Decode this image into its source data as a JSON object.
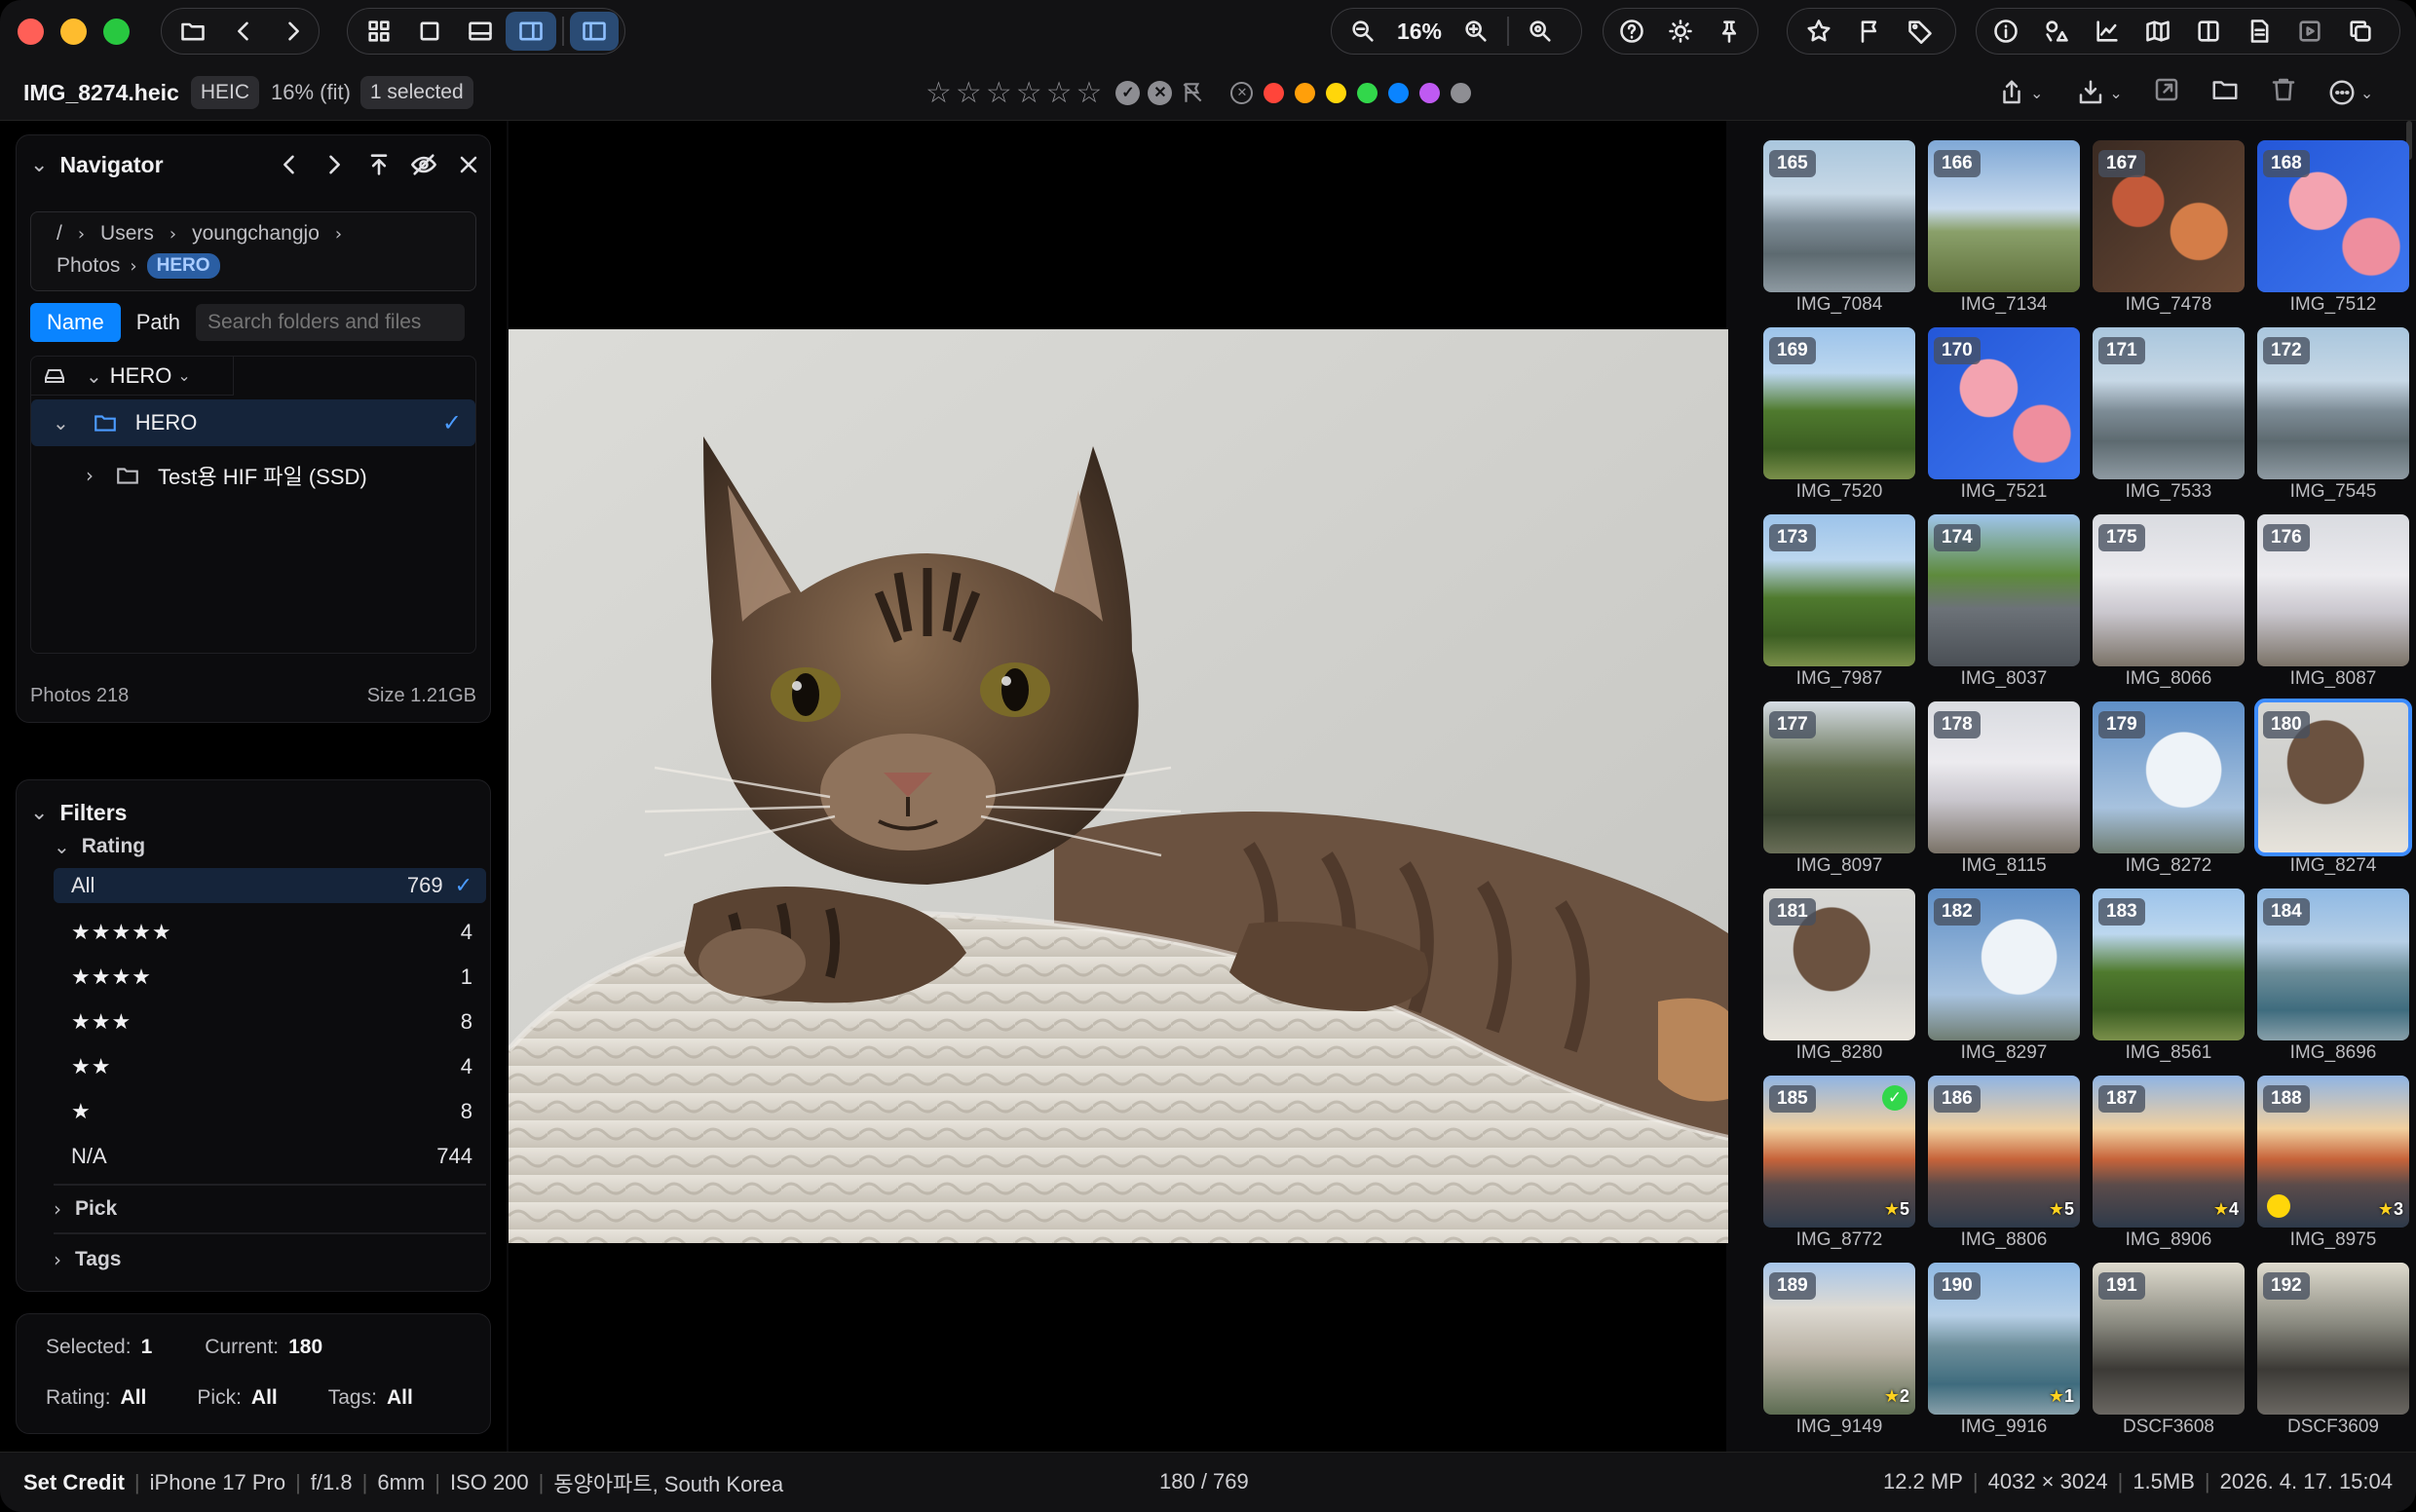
{
  "window": {
    "traffic_lights": {
      "close": "#ff5f57",
      "minimize": "#febc2e",
      "zoom": "#28c840"
    },
    "accent": "#3d8cff"
  },
  "toolbar": {
    "zoom_level": "16%"
  },
  "infobar": {
    "filename": "IMG_8274.heic",
    "format_badge": "HEIC",
    "zoom_fit": "16% (fit)",
    "selected_badge": "1 selected",
    "rating_stars": [
      "☆",
      "☆",
      "☆",
      "☆",
      "☆",
      "☆"
    ],
    "color_labels": [
      "#ff453a",
      "#ff9f0a",
      "#ffd60a",
      "#32d74b",
      "#0a84ff",
      "#bf5af2",
      "#8e8e93"
    ]
  },
  "navigator": {
    "title": "Navigator",
    "path": [
      "/",
      "Users",
      "youngchangjo",
      "Photos"
    ],
    "current_folder": "HERO",
    "tab_name": "Name",
    "tab_path": "Path",
    "search_placeholder": "Search folders and files",
    "volume": "HERO",
    "tree": [
      {
        "label": "HERO",
        "selected": true,
        "expanded": true
      },
      {
        "label": "Test용 HIF 파일 (SSD)",
        "selected": false,
        "expanded": false
      }
    ],
    "photos_count": "Photos 218",
    "size": "Size 1.21GB"
  },
  "filters": {
    "title": "Filters",
    "rating_title": "Rating",
    "rows": [
      {
        "label": "All",
        "count": "769",
        "stars": ""
      },
      {
        "label": "",
        "count": "4",
        "stars": "★★★★★"
      },
      {
        "label": "",
        "count": "1",
        "stars": "★★★★"
      },
      {
        "label": "",
        "count": "8",
        "stars": "★★★"
      },
      {
        "label": "",
        "count": "4",
        "stars": "★★"
      },
      {
        "label": "",
        "count": "8",
        "stars": "★"
      },
      {
        "label": "N/A",
        "count": "744",
        "stars": ""
      }
    ],
    "pick_title": "Pick",
    "tags_title": "Tags"
  },
  "summary": {
    "selected_label": "Selected:",
    "selected_value": "1",
    "current_label": "Current:",
    "current_value": "180",
    "rating_label": "Rating:",
    "rating_value": "All",
    "pick_label": "Pick:",
    "pick_value": "All",
    "tags_label": "Tags:",
    "tags_value": "All"
  },
  "grid": {
    "items": [
      {
        "num": "165",
        "name": "IMG_7084",
        "theme": "city"
      },
      {
        "num": "166",
        "name": "IMG_7134",
        "theme": "tree"
      },
      {
        "num": "167",
        "name": "IMG_7478",
        "theme": "food"
      },
      {
        "num": "168",
        "name": "IMG_7512",
        "theme": "blossom"
      },
      {
        "num": "169",
        "name": "IMG_7520",
        "theme": "park"
      },
      {
        "num": "170",
        "name": "IMG_7521",
        "theme": "blossom"
      },
      {
        "num": "171",
        "name": "IMG_7533",
        "theme": "city"
      },
      {
        "num": "172",
        "name": "IMG_7545",
        "theme": "city"
      },
      {
        "num": "173",
        "name": "IMG_7987",
        "theme": "park"
      },
      {
        "num": "174",
        "name": "IMG_8037",
        "theme": "road"
      },
      {
        "num": "175",
        "name": "IMG_8066",
        "theme": "cherry"
      },
      {
        "num": "176",
        "name": "IMG_8087",
        "theme": "cherry"
      },
      {
        "num": "177",
        "name": "IMG_8097",
        "theme": "forest"
      },
      {
        "num": "178",
        "name": "IMG_8115",
        "theme": "cherry"
      },
      {
        "num": "179",
        "name": "IMG_8272",
        "theme": "sky"
      },
      {
        "num": "180",
        "name": "IMG_8274",
        "theme": "cat",
        "selected": true
      },
      {
        "num": "181",
        "name": "IMG_8280",
        "theme": "cat"
      },
      {
        "num": "182",
        "name": "IMG_8297",
        "theme": "sky"
      },
      {
        "num": "183",
        "name": "IMG_8561",
        "theme": "park"
      },
      {
        "num": "184",
        "name": "IMG_8696",
        "theme": "river"
      },
      {
        "num": "185",
        "name": "IMG_8772",
        "theme": "sunset",
        "rating": "5",
        "pick": true
      },
      {
        "num": "186",
        "name": "IMG_8806",
        "theme": "sunset",
        "rating": "5"
      },
      {
        "num": "187",
        "name": "IMG_8906",
        "theme": "sunset",
        "rating": "4"
      },
      {
        "num": "188",
        "name": "IMG_8975",
        "theme": "sunset",
        "rating": "3",
        "color_dot": "#ffd60a"
      },
      {
        "num": "189",
        "name": "IMG_9149",
        "theme": "building",
        "rating": "2"
      },
      {
        "num": "190",
        "name": "IMG_9916",
        "theme": "river",
        "rating": "1"
      },
      {
        "num": "191",
        "name": "DSCF3608",
        "theme": "interior"
      },
      {
        "num": "192",
        "name": "DSCF3609",
        "theme": "interior"
      }
    ]
  },
  "status": {
    "credit": "Set Credit",
    "camera": "iPhone 17 Pro",
    "aperture": "f/1.8",
    "focal": "6mm",
    "iso": "ISO 200",
    "location": "동양아파트, South Korea",
    "position": "180 / 769",
    "megapixels": "12.2 MP",
    "dimensions": "4032 × 3024",
    "filesize": "1.5MB",
    "datetime": "2026. 4. 17. 15:04"
  }
}
